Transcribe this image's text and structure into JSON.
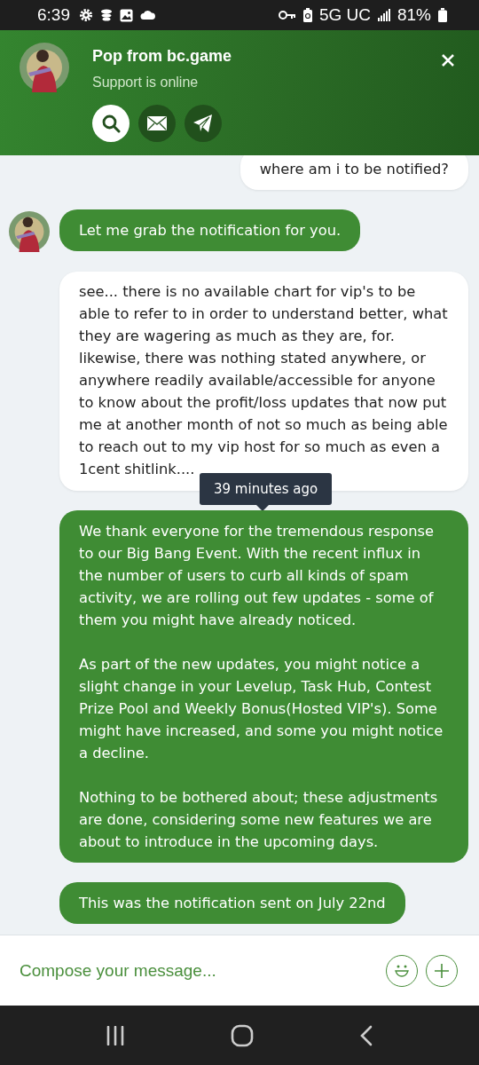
{
  "status_bar": {
    "time": "6:39",
    "network": "5G UC",
    "battery": "81%"
  },
  "header": {
    "title": "Pop from bc.game",
    "subtitle": "Support is online",
    "actions": [
      {
        "kind": "search",
        "selected": true
      },
      {
        "kind": "mail",
        "selected": false
      },
      {
        "kind": "telegram",
        "selected": false
      }
    ]
  },
  "messages": [
    {
      "kind": "user",
      "avatar": false,
      "paragraphs": [
        "where am i to be notified?"
      ]
    },
    {
      "kind": "agent",
      "avatar": true,
      "paragraphs": [
        "Let me grab the notification for you."
      ]
    },
    {
      "kind": "userwide",
      "avatar": false,
      "paragraphs": [
        "see... there is no available chart for vip's to be able to refer to in order to understand better, what they are wagering as much as they are, for. likewise, there was nothing stated anywhere, or anywhere readily available/accessible for anyone to know about the profit/loss updates that now put me at another month of not so much as being able to reach out to my vip host for so much as even a 1cent shitlink...."
      ],
      "tooltip": "39 minutes ago"
    },
    {
      "kind": "agent",
      "avatar": false,
      "paragraphs": [
        "We thank everyone for the tremendous response to our Big Bang Event. With the recent influx in the number of users to curb all kinds of spam activity, we are rolling out few updates - some of them you might have already noticed.",
        "As part of the new updates, you might notice a slight change in your Levelup, Task Hub, Contest Prize Pool and Weekly Bonus(Hosted VIP's). Some might have increased, and some you might notice a decline.",
        "Nothing to be bothered about; these adjustments are done, considering some new features we are about to introduce in the upcoming days."
      ]
    },
    {
      "kind": "agent",
      "avatar": false,
      "paragraphs": [
        "This was the notification sent on July 22nd"
      ]
    }
  ],
  "composer": {
    "placeholder": "Compose your message..."
  }
}
